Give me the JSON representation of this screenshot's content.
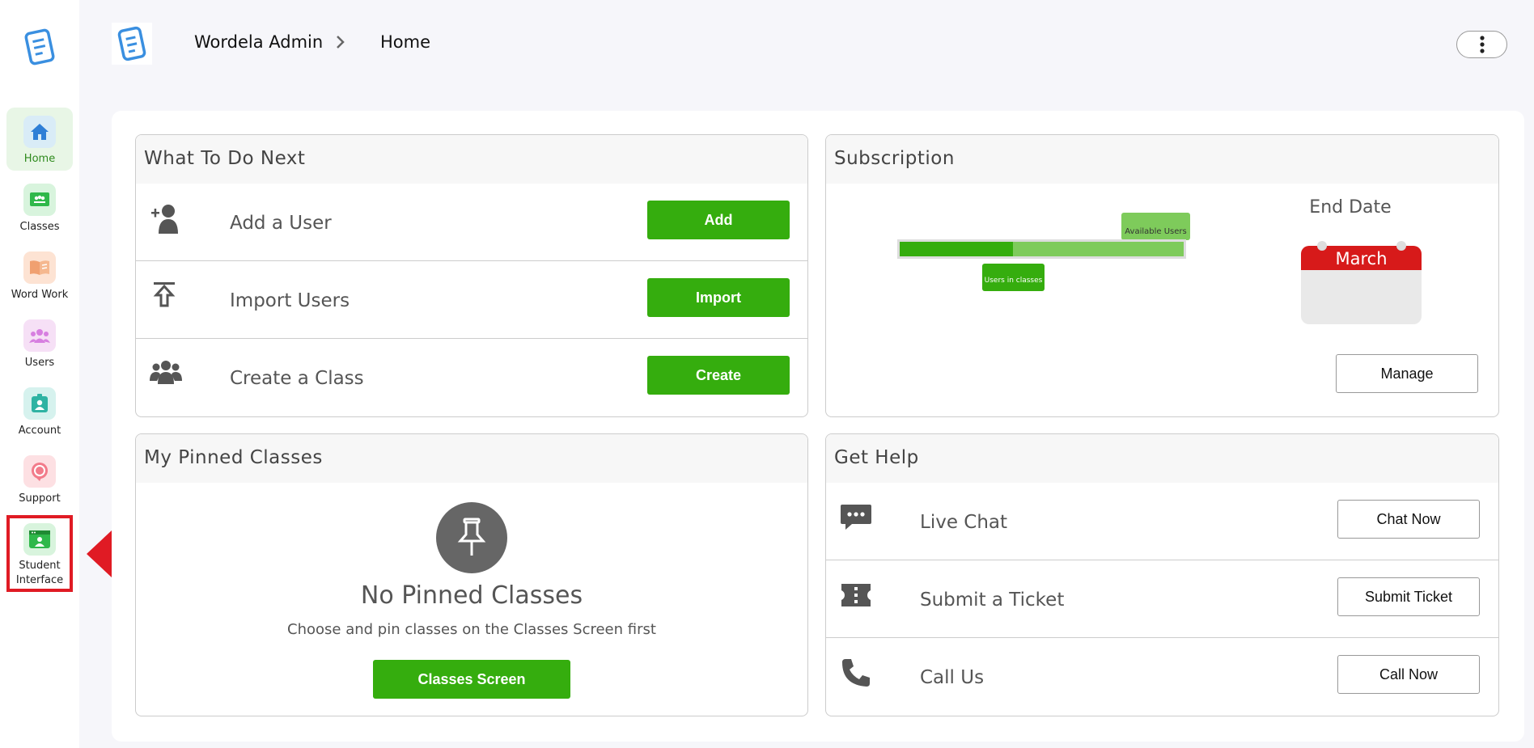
{
  "sidebar": {
    "items": [
      {
        "label": "Home",
        "icon": "home-icon",
        "color": "#d9ecf7"
      },
      {
        "label": "Classes",
        "icon": "classes-icon",
        "color": "#d8f4dd"
      },
      {
        "label": "Word Work",
        "icon": "book-icon",
        "color": "#fde3d3"
      },
      {
        "label": "Users",
        "icon": "users-icon",
        "color": "#f6e0f6"
      },
      {
        "label": "Account",
        "icon": "account-icon",
        "color": "#d6f2ee"
      },
      {
        "label": "Support",
        "icon": "support-icon",
        "color": "#fde0e3"
      },
      {
        "label": "Student Interface",
        "icon": "student-interface-icon",
        "color": "#d8f4dd"
      }
    ]
  },
  "header": {
    "breadcrumb_root": "Wordela Admin",
    "breadcrumb_current": "Home"
  },
  "todo": {
    "title": "What To Do Next",
    "rows": [
      {
        "label": "Add a User",
        "button": "Add",
        "icon": "add-user-icon"
      },
      {
        "label": "Import Users",
        "button": "Import",
        "icon": "upload-icon"
      },
      {
        "label": "Create a Class",
        "button": "Create",
        "icon": "group-icon"
      }
    ]
  },
  "subscription": {
    "title": "Subscription",
    "available_label": "Available Users",
    "in_classes_label": "Users in classes",
    "in_classes_fraction": 0.4,
    "end_date_label": "End Date",
    "month": "March",
    "manage_button": "Manage"
  },
  "pinned": {
    "title": "My Pinned Classes",
    "empty_title": "No Pinned Classes",
    "empty_text": "Choose and pin classes on the Classes Screen first",
    "button": "Classes Screen"
  },
  "help": {
    "title": "Get Help",
    "rows": [
      {
        "label": "Live Chat",
        "button": "Chat Now",
        "icon": "chat-icon"
      },
      {
        "label": "Submit a Ticket",
        "button": "Submit Ticket",
        "icon": "ticket-icon"
      },
      {
        "label": "Call Us",
        "button": "Call Now",
        "icon": "phone-icon"
      }
    ]
  },
  "colors": {
    "accent": "#35ad0e",
    "highlight": "#e01b24"
  }
}
